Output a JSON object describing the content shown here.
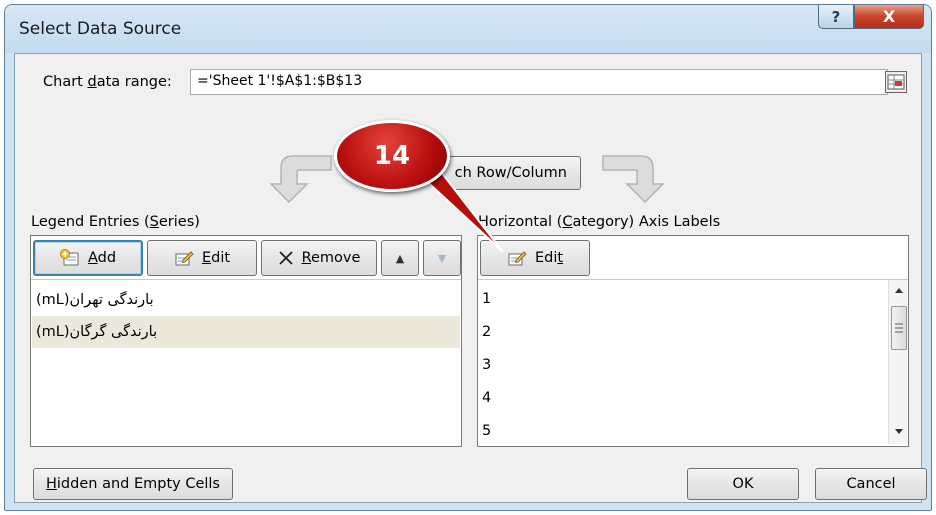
{
  "window": {
    "title": "Select Data Source",
    "help_glyph": "?",
    "close_glyph": "X"
  },
  "range": {
    "label_pre": "Chart ",
    "label_key": "d",
    "label_post": "ata range:",
    "value": "='Sheet 1'!$A$1:$B$13"
  },
  "switch_button": {
    "label": "ch Row/Column"
  },
  "callout": {
    "number": "14",
    "color": "#c0120f"
  },
  "legend": {
    "heading_pre": "Legend Entries (",
    "heading_key": "S",
    "heading_post": "eries)",
    "add_key": "A",
    "add_rest": "dd",
    "edit_key": "E",
    "edit_rest": "dit",
    "remove_key": "R",
    "remove_rest": "emove",
    "up_glyph": "▲",
    "down_glyph": "▼",
    "series": [
      "بارندگی تهران(mL)",
      "بارندگی گرگان(mL)"
    ]
  },
  "axis": {
    "heading_pre": "Horizontal (",
    "heading_key": "C",
    "heading_post": "ategory) Axis Labels",
    "edit_pre": "Edi",
    "edit_key": "t",
    "labels": [
      "1",
      "2",
      "3",
      "4",
      "5"
    ]
  },
  "footer": {
    "hidden_key": "H",
    "hidden_rest": "idden and Empty Cells",
    "ok": "OK",
    "cancel": "Cancel"
  },
  "colors": {
    "accent": "#3c7fb1",
    "selection": "#ece8dc",
    "titlebar": "#c4dbef"
  }
}
